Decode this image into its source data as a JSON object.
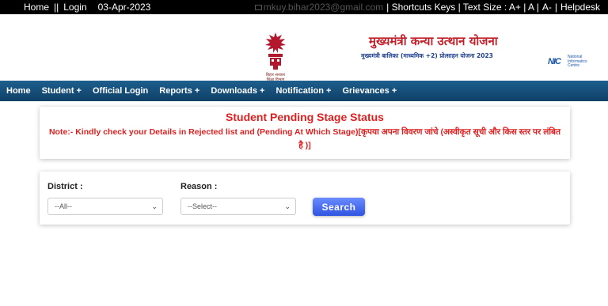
{
  "topbar": {
    "home": "Home",
    "sep": "||",
    "login": "Login",
    "date": "03-Apr-2023",
    "email": "mkuy.bihar2023@gmail.com",
    "shortcuts": "| Shortcuts Keys | Text Size : A+ | A |",
    "text_minus": "A-",
    "bar": "|",
    "helpdesk": "Helpdesk"
  },
  "header": {
    "scheme_title": "मुख्यमंत्री कन्या उत्थान योजना",
    "scheme_subtitle": "मुख्यमंत्री बालिका (माध्यमिक +2) प्रोत्साहन योजना 2023",
    "emblem_caption": "बिहार सरकार शिक्षा विभाग",
    "nic_line1": "National",
    "nic_line2": "Informatics",
    "nic_line3": "Centre",
    "nic_mark": "NIC"
  },
  "nav": {
    "items": [
      {
        "label": "Home"
      },
      {
        "label": "Student +"
      },
      {
        "label": "Official Login"
      },
      {
        "label": "Reports +"
      },
      {
        "label": "Downloads +"
      },
      {
        "label": "Notification +"
      },
      {
        "label": "Grievances +"
      }
    ]
  },
  "status_card": {
    "title": "Student Pending Stage Status",
    "note": "Note:-  Kindly check your Details in Rejected list and (Pending At Which Stage)[कृपया अपना विवरण जांचे (अस्वीकृत सूची और किस स्तर पर लंबित है )]"
  },
  "filters": {
    "district_label": "District :",
    "district_value": "--All--",
    "reason_label": "Reason :",
    "reason_value": "--Select--",
    "search_label": "Search"
  },
  "colors": {
    "nav_bg": "#0f3f66",
    "accent_red": "#e02020",
    "search_btn": "#3a5ee8"
  }
}
